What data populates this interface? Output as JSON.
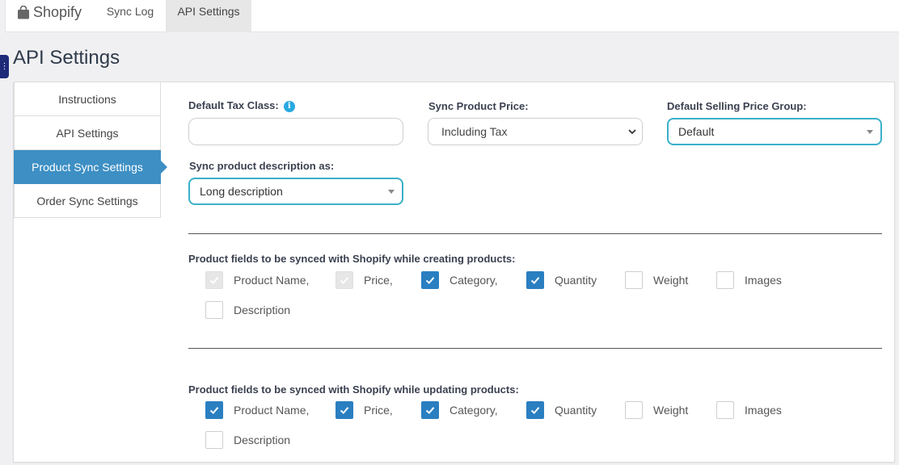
{
  "nav": {
    "brand": "Shopify",
    "tabs": [
      "Sync Log",
      "API Settings"
    ]
  },
  "page": {
    "title": "API Settings"
  },
  "sidebar": {
    "items": [
      {
        "label": "Instructions"
      },
      {
        "label": "API Settings"
      },
      {
        "label": "Product Sync Settings",
        "active": true
      },
      {
        "label": "Order Sync Settings"
      }
    ]
  },
  "form": {
    "tax_class_label": "Default Tax Class:",
    "tax_class_value": "",
    "price_label": "Sync Product Price:",
    "price_value": "Including Tax",
    "price_group_label": "Default Selling Price Group:",
    "price_group_value": "Default",
    "description_label": "Sync product description as:",
    "description_value": "Long description"
  },
  "create_fields": {
    "heading": "Product fields to be synced with Shopify while creating products:",
    "items": [
      {
        "label": "Product Name,",
        "state": "disabled-checked"
      },
      {
        "label": "Price,",
        "state": "disabled-checked"
      },
      {
        "label": "Category,",
        "state": "checked"
      },
      {
        "label": "Quantity",
        "state": "checked"
      },
      {
        "label": "Weight",
        "state": "unchecked"
      },
      {
        "label": "Images",
        "state": "unchecked"
      },
      {
        "label": "Description",
        "state": "unchecked"
      }
    ]
  },
  "update_fields": {
    "heading": "Product fields to be synced with Shopify while updating products:",
    "items": [
      {
        "label": "Product Name,",
        "state": "checked"
      },
      {
        "label": "Price,",
        "state": "checked"
      },
      {
        "label": "Category,",
        "state": "checked"
      },
      {
        "label": "Quantity",
        "state": "checked"
      },
      {
        "label": "Weight",
        "state": "unchecked"
      },
      {
        "label": "Images",
        "state": "unchecked"
      },
      {
        "label": "Description",
        "state": "unchecked"
      }
    ]
  },
  "colors": {
    "accent": "#3d8fc4",
    "checkbox_checked": "#2a7fc1",
    "select_focus": "#3ab0c9",
    "info": "#27a9e1",
    "sidebar_toggle": "#1e2b78"
  }
}
